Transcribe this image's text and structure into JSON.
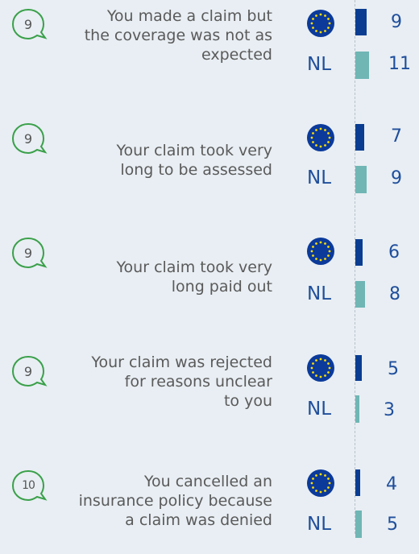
{
  "eu_flag_icon": "eu-flag-icon",
  "colors": {
    "eu_bar": "#0a3d91",
    "nl_bar": "#6fb6b5",
    "text_blue": "#1f4e9c",
    "badge_green": "#3aa04a"
  },
  "chart_data": {
    "type": "bar",
    "orientation": "horizontal",
    "grid": false,
    "categories": [
      "You made a claim but the coverage was not as expected",
      "Your claim took very long to be assessed",
      "Your claim took very long paid out",
      "Your claim was rejected for reasons unclear to you",
      "You cancelled an insurance policy because a claim was denied"
    ],
    "badges": [
      "9",
      "9",
      "9",
      "9",
      "10"
    ],
    "series": [
      {
        "name": "",
        "values": [
          9,
          7,
          6,
          5,
          4
        ],
        "color": "#0a3d91"
      },
      {
        "name": "NL",
        "values": [
          11,
          9,
          8,
          3,
          5
        ],
        "color": "#6fb6b5"
      }
    ],
    "rows": [
      {
        "badge": "9",
        "label_lines": [
          "You made a claim but",
          "the coverage was not as",
          "expected"
        ],
        "eu": "9",
        "nl_label": "NL",
        "nl": "11"
      },
      {
        "badge": "9",
        "label_lines": [
          "Your claim took very",
          "long to be assessed"
        ],
        "eu": "7",
        "nl_label": "NL",
        "nl": "9"
      },
      {
        "badge": "9",
        "label_lines": [
          "Your claim took very",
          "long paid out"
        ],
        "eu": "6",
        "nl_label": "NL",
        "nl": "8"
      },
      {
        "badge": "9",
        "label_lines": [
          "Your claim was rejected",
          "for reasons unclear",
          "to you"
        ],
        "eu": "5",
        "nl_label": "NL",
        "nl": "3"
      },
      {
        "badge": "10",
        "label_lines": [
          "You cancelled an",
          "insurance policy because",
          "a claim was denied"
        ],
        "eu": "4",
        "nl_label": "NL",
        "nl": "5"
      }
    ]
  }
}
